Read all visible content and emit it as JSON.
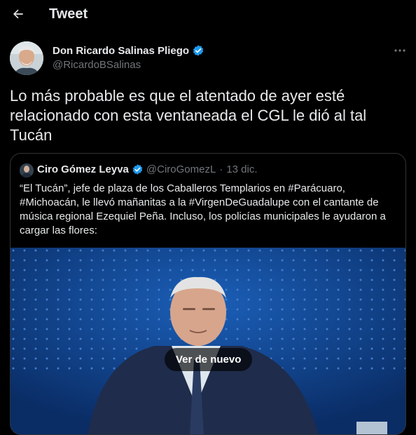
{
  "header": {
    "title": "Tweet"
  },
  "tweet": {
    "author_name": "Don Ricardo Salinas Pliego",
    "author_handle": "@RicardoBSalinas",
    "text": "Lo más probable es que el atentado de ayer esté relacionado con esta ventaneada el CGL le dió al tal Tucán"
  },
  "quote": {
    "author_name": "Ciro Gómez Leyva",
    "author_handle": "@CiroGomezL",
    "separator": "·",
    "date": "13 dic.",
    "text": "“El Tucán”, jefe de plaza de los Caballeros Templarios en #Parácuaro, #Michoacán, le llevó mañanitas a la #VirgenDeGuadalupe con el cantante de música regional Ezequiel Peña. Incluso, los policías municipales le ayudaron a cargar las flores:",
    "video_overlay_label": "Ver de nuevo"
  },
  "icons": {
    "back": "arrow-left-icon",
    "verified": "verified-badge-icon",
    "more": "more-horizontal-icon"
  },
  "colors": {
    "background": "#000000",
    "text_primary": "#e7e9ea",
    "text_secondary": "#71767b",
    "verified_blue": "#1d9bf0",
    "border": "#2f3336"
  }
}
